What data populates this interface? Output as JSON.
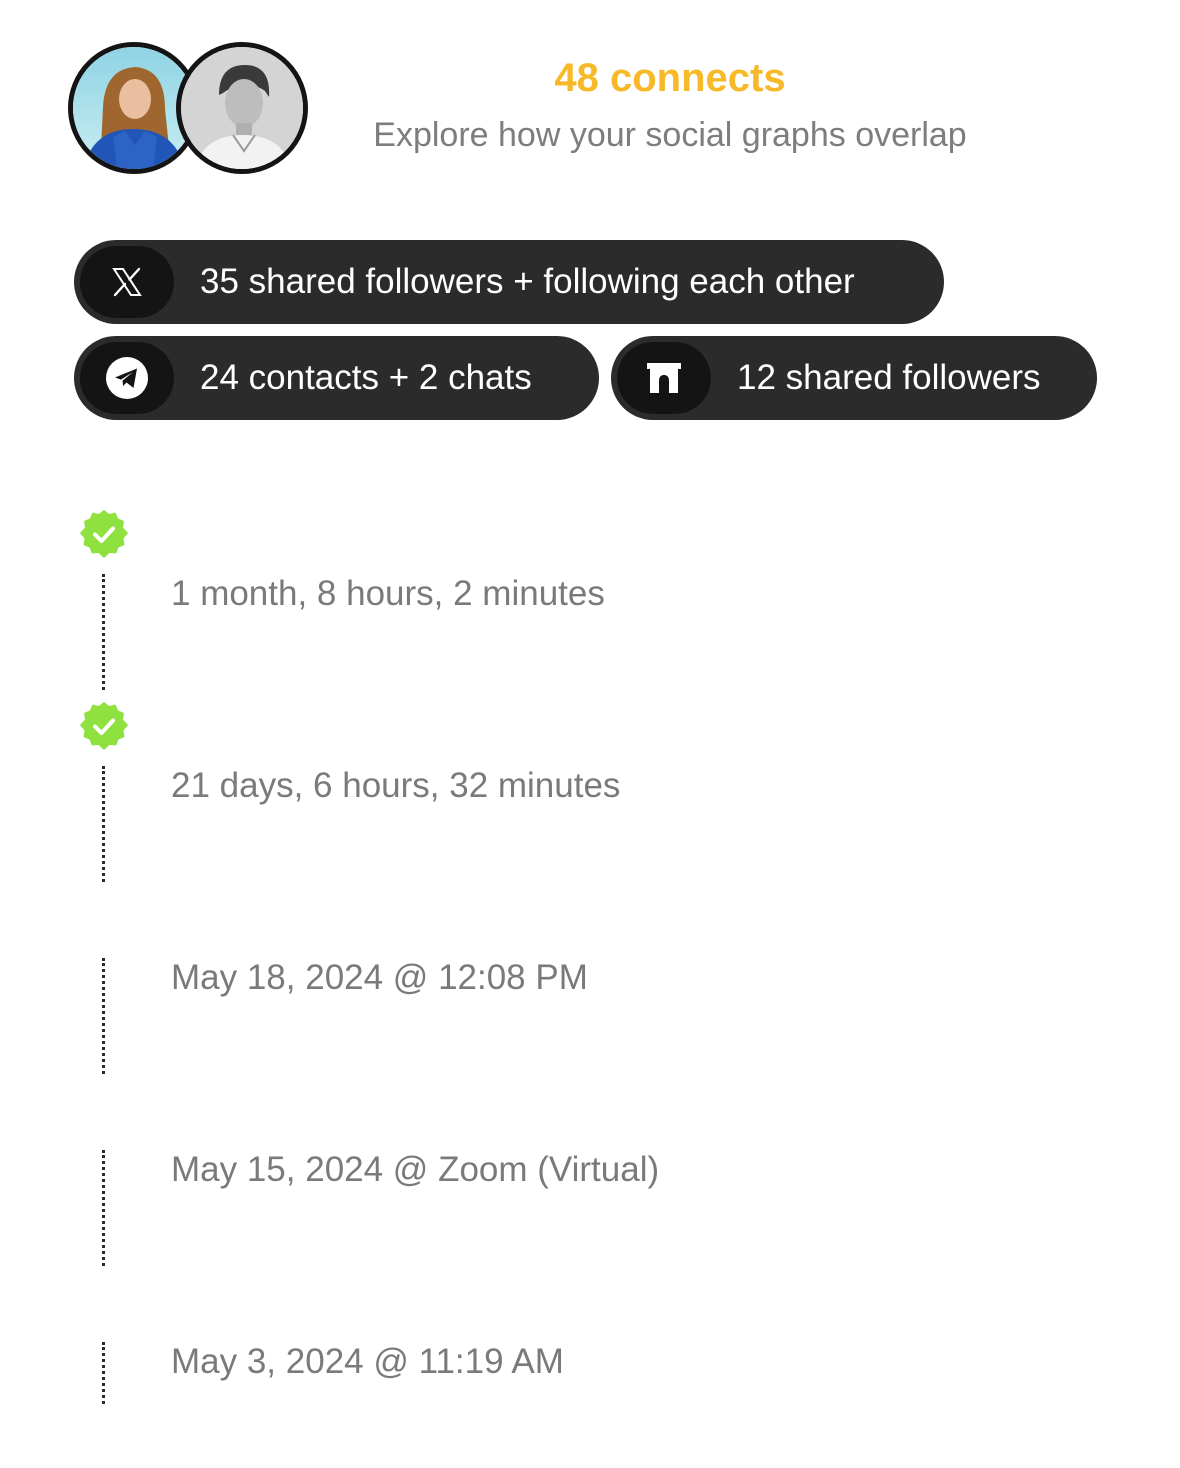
{
  "header": {
    "connects": "48 connects",
    "subtitle": "Explore how your social graphs overlap",
    "accent_color": "#f7b928",
    "avatars": [
      {
        "name": "avatar-woman"
      },
      {
        "name": "avatar-man"
      }
    ]
  },
  "pills": [
    {
      "icon": "x-logo-icon",
      "label": "35 shared followers + following each other"
    },
    {
      "icon": "telegram-icon",
      "label": "24 contacts + 2 chats"
    },
    {
      "icon": "farcaster-arch-icon",
      "label": "12 shared followers"
    }
  ],
  "timeline": [
    {
      "verified": true,
      "text": "1 month, 8 hours, 2 minutes"
    },
    {
      "verified": true,
      "text": "21 days, 6 hours, 32 minutes"
    },
    {
      "verified": false,
      "text": "May 18, 2024 @ 12:08 PM"
    },
    {
      "verified": false,
      "text": "May 15, 2024 @ Zoom (Virtual)"
    },
    {
      "verified": false,
      "text": "May 3, 2024 @ 11:19 AM"
    }
  ],
  "colors": {
    "pill_bg": "#2b2b2b",
    "verified_green": "#8fe140",
    "muted_text": "#7a7a7a"
  }
}
